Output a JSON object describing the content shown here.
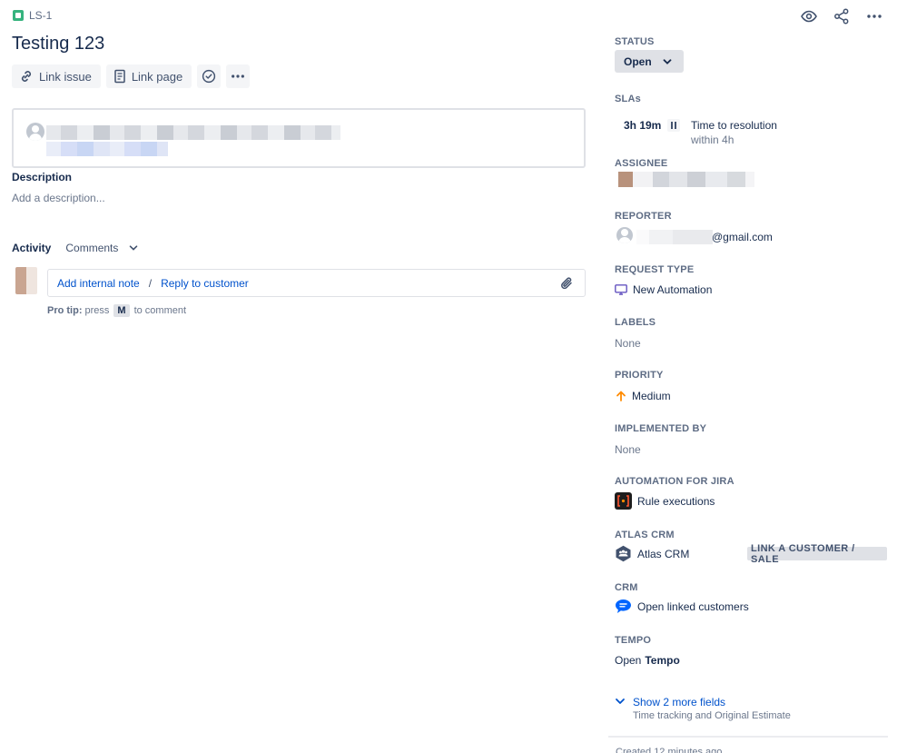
{
  "issue": {
    "key": "LS-1",
    "title": "Testing 123"
  },
  "toolbar": {
    "link_issue": "Link issue",
    "link_page": "Link page"
  },
  "description": {
    "label": "Description",
    "placeholder": "Add a description..."
  },
  "activity": {
    "label": "Activity",
    "filter": "Comments",
    "add_internal_note": "Add internal note",
    "separator": "/",
    "reply_to_customer": "Reply to customer",
    "pro_tip_label": "Pro tip:",
    "pro_tip_press": "press",
    "pro_tip_key": "M",
    "pro_tip_rest": "to comment"
  },
  "sidebar": {
    "status": {
      "label": "STATUS",
      "value": "Open"
    },
    "slas": {
      "label": "SLAs",
      "time": "3h 19m",
      "name": "Time to resolution",
      "target": "within 4h"
    },
    "assignee": {
      "label": "ASSIGNEE"
    },
    "reporter": {
      "label": "REPORTER",
      "email_suffix": "@gmail.com"
    },
    "request_type": {
      "label": "REQUEST TYPE",
      "value": "New Automation"
    },
    "labels": {
      "label": "LABELS",
      "value": "None"
    },
    "priority": {
      "label": "PRIORITY",
      "value": "Medium"
    },
    "implemented_by": {
      "label": "IMPLEMENTED BY",
      "value": "None"
    },
    "automation": {
      "label": "AUTOMATION FOR JIRA",
      "value": "Rule executions"
    },
    "atlas_crm": {
      "label": "ATLAS CRM",
      "value": "Atlas CRM",
      "action": "LINK A CUSTOMER / SALE"
    },
    "crm": {
      "label": "CRM",
      "value": "Open linked customers"
    },
    "tempo": {
      "label": "TEMPO",
      "prefix": "Open",
      "value": "Tempo"
    },
    "show_more": {
      "label": "Show 2 more fields",
      "sub": "Time tracking and Original Estimate"
    },
    "footer_cut": "Created 12 minutes ago"
  },
  "colors": {
    "link": "#0052cc",
    "text": "#172b4d",
    "muted": "#6b778c",
    "priority_medium": "#ff8b00",
    "issue_type": "#36b37e"
  },
  "icons": {
    "watch": "eye-icon",
    "share": "share-icon",
    "more": "more-icon",
    "link": "link-icon",
    "page": "page-icon",
    "check": "check-circle-icon",
    "attach": "paperclip-icon"
  }
}
